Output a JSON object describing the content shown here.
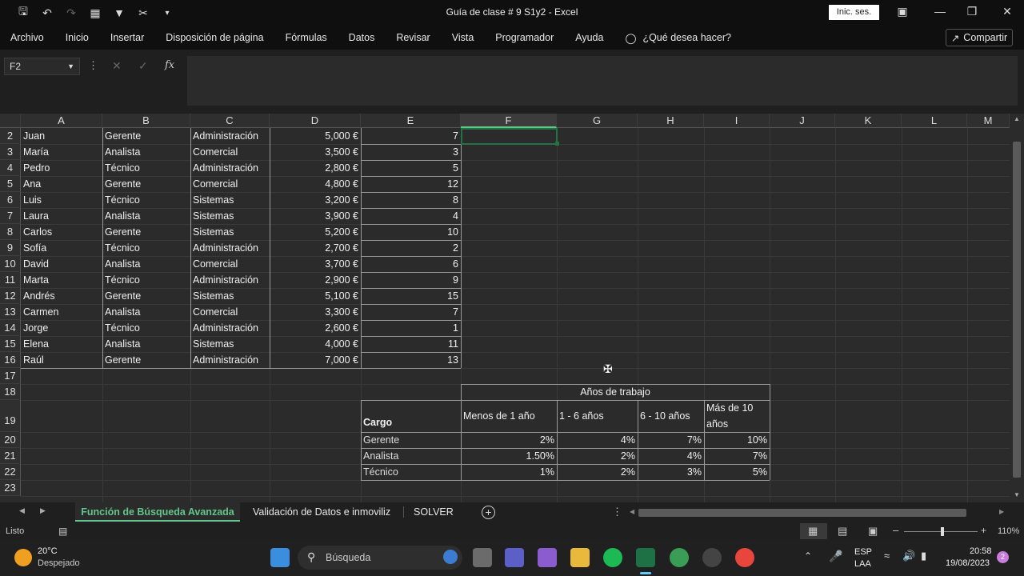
{
  "window": {
    "title": "Guía de clase # 9 S1y2  -  Excel",
    "signin_label": "Inic. ses.",
    "qa_icons": [
      "save-icon",
      "undo-icon",
      "redo-icon",
      "form-icon",
      "filter-icon",
      "cut-icon",
      "customize-icon"
    ]
  },
  "menu": {
    "items": [
      "Archivo",
      "Inicio",
      "Insertar",
      "Disposición de página",
      "Fórmulas",
      "Datos",
      "Revisar",
      "Vista",
      "Programador",
      "Ayuda"
    ],
    "tell_me": "¿Qué desea hacer?",
    "share_label": "Compartir"
  },
  "formula_bar": {
    "name_box": "F2",
    "fx": "fx",
    "content": ""
  },
  "columns": [
    "A",
    "B",
    "C",
    "D",
    "E",
    "F",
    "G",
    "H",
    "I",
    "J",
    "K",
    "L",
    "M"
  ],
  "rows": [
    "2",
    "3",
    "4",
    "5",
    "6",
    "7",
    "8",
    "9",
    "10",
    "11",
    "12",
    "13",
    "14",
    "15",
    "16",
    "17",
    "18",
    "19",
    "20",
    "21",
    "22",
    "23"
  ],
  "data_rows": [
    [
      "Juan",
      "Gerente",
      "Administración",
      "5,000 €",
      "7"
    ],
    [
      "María",
      "Analista",
      "Comercial",
      "3,500 €",
      "3"
    ],
    [
      "Pedro",
      "Técnico",
      "Administración",
      "2,800 €",
      "5"
    ],
    [
      "Ana",
      "Gerente",
      "Comercial",
      "4,800 €",
      "12"
    ],
    [
      "Luis",
      "Técnico",
      "Sistemas",
      "3,200 €",
      "8"
    ],
    [
      "Laura",
      "Analista",
      "Sistemas",
      "3,900 €",
      "4"
    ],
    [
      "Carlos",
      "Gerente",
      "Sistemas",
      "5,200 €",
      "10"
    ],
    [
      "Sofía",
      "Técnico",
      "Administración",
      "2,700 €",
      "2"
    ],
    [
      "David",
      "Analista",
      "Comercial",
      "3,700 €",
      "6"
    ],
    [
      "Marta",
      "Técnico",
      "Administración",
      "2,900 €",
      "9"
    ],
    [
      "Andrés",
      "Gerente",
      "Sistemas",
      "5,100 €",
      "15"
    ],
    [
      "Carmen",
      "Analista",
      "Comercial",
      "3,300 €",
      "7"
    ],
    [
      "Jorge",
      "Técnico",
      "Administración",
      "2,600 €",
      "1"
    ],
    [
      "Elena",
      "Analista",
      "Sistemas",
      "4,000 €",
      "11"
    ],
    [
      "Raúl",
      "Gerente",
      "Administración",
      "7,000 €",
      "13"
    ]
  ],
  "lookup_table": {
    "header": "Años de trabajo",
    "cargo_label": "Cargo",
    "ranges": [
      "Menos de 1 año",
      "1 - 6 años",
      "6 - 10 años",
      "Más de 10 años"
    ],
    "rows": [
      {
        "cargo": "Gerente",
        "values": [
          "2%",
          "4%",
          "7%",
          "10%"
        ]
      },
      {
        "cargo": "Analista",
        "values": [
          "1.50%",
          "2%",
          "4%",
          "7%"
        ]
      },
      {
        "cargo": "Técnico",
        "values": [
          "1%",
          "2%",
          "3%",
          "5%"
        ]
      }
    ]
  },
  "sheet_tabs": {
    "tabs": [
      "Función de Búsqueda Avanzada",
      "Validación de Datos e inmoviliz",
      "SOLVER"
    ],
    "active": "Función de Búsqueda Avanzada"
  },
  "status": {
    "ready": "Listo",
    "zoom": "110%"
  },
  "taskbar": {
    "weather_temp": "20°C",
    "weather_desc": "Despejado",
    "search": "Búsqueda",
    "lang1": "ESP",
    "lang2": "LAA",
    "time": "20:58",
    "date": "19/08/2023",
    "notif": "2"
  },
  "colors": {
    "accent_green": "#1e7145",
    "tab_text_green": "#64c58b",
    "selection": "#217346"
  }
}
